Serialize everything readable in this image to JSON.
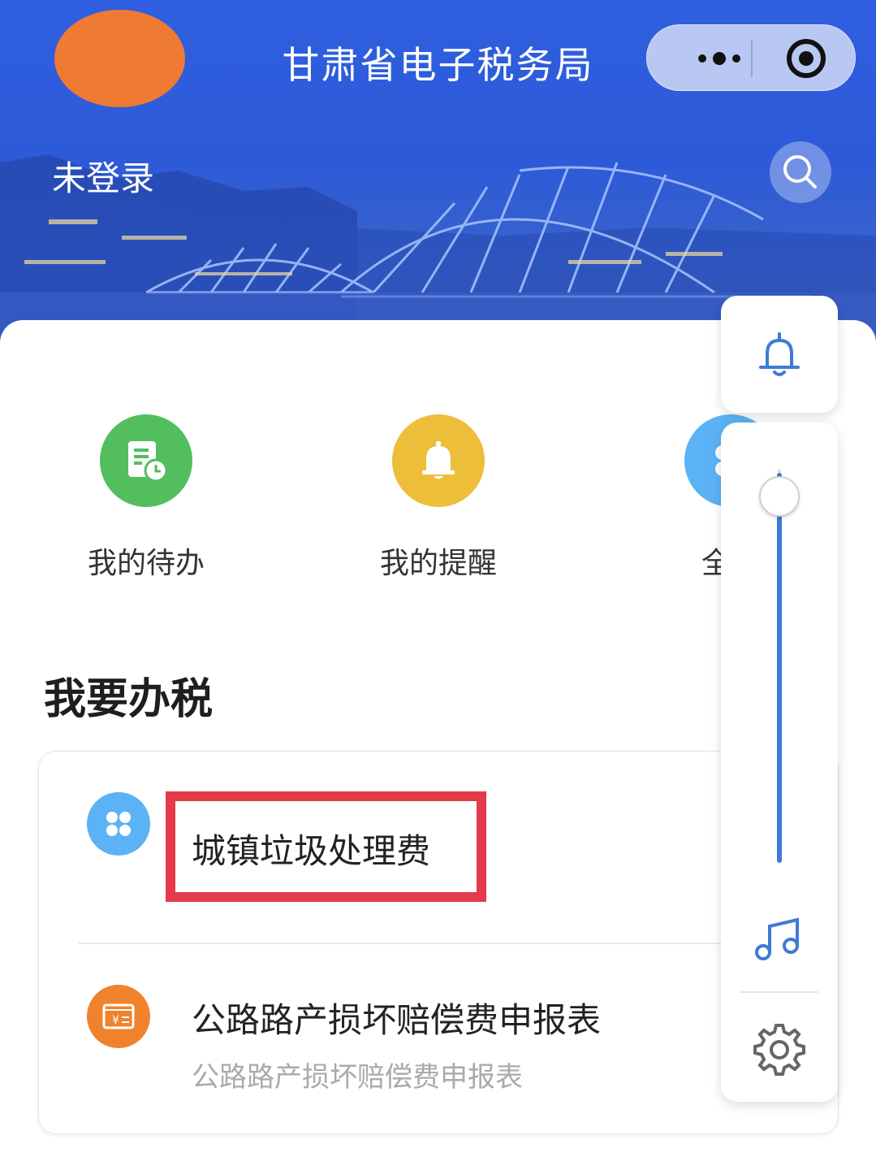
{
  "header": {
    "app_title": "甘肃省电子税务局",
    "login_status": "未登录",
    "avatar_color": "#ee7a33",
    "capsule_icons": [
      "more-dots-icon",
      "target-circle-icon"
    ],
    "search_icon": "search-icon"
  },
  "quick_actions": [
    {
      "label": "我的待办",
      "icon": "todo-document-clock-icon",
      "color": "#52be5e"
    },
    {
      "label": "我的提醒",
      "icon": "bell-icon",
      "color": "#ecbe3a"
    },
    {
      "label": "全部",
      "icon": "grid-icon",
      "color": "#5bb3f5"
    }
  ],
  "section": {
    "title": "我要办税"
  },
  "tasks": [
    {
      "title": "城镇垃圾处理费",
      "subtitle": "",
      "icon": "four-dots-icon",
      "icon_color": "#5bb3f5",
      "highlighted": true
    },
    {
      "title": "公路路产损坏赔偿费申报表",
      "subtitle": "公路路产损坏赔偿费申报表",
      "icon": "receipt-yen-icon",
      "icon_color": "#f0822e",
      "highlighted": false
    }
  ],
  "side_panel": {
    "top_icon": "bell-outline-icon",
    "slider_level": 0.0,
    "music_icon": "music-note-icon",
    "settings_icon": "gear-icon",
    "accent_color": "#3d7bd6"
  },
  "highlight_color": "#e53a4a"
}
